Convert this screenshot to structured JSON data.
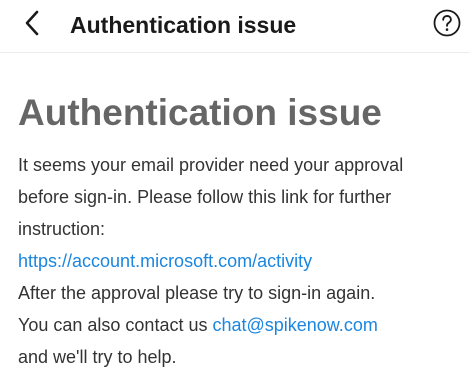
{
  "header": {
    "title": "Authentication issue",
    "back_icon": "chevron-left-icon",
    "help_icon": "help-circle-icon"
  },
  "main": {
    "heading": "Authentication issue",
    "lines": [
      "It seems your email provider need your approval",
      "before sign-in. Please follow this link for further",
      "instruction:"
    ],
    "link_url_text": "https://account.microsoft.com/activity",
    "after_text": "After the approval please try to sign-in again.",
    "contact_prefix": "You can also contact us ",
    "contact_email": "chat@spikenow.com",
    "closing_text": "and we'll try to help."
  },
  "colors": {
    "link": "#1a86e0",
    "heading": "#666666"
  }
}
